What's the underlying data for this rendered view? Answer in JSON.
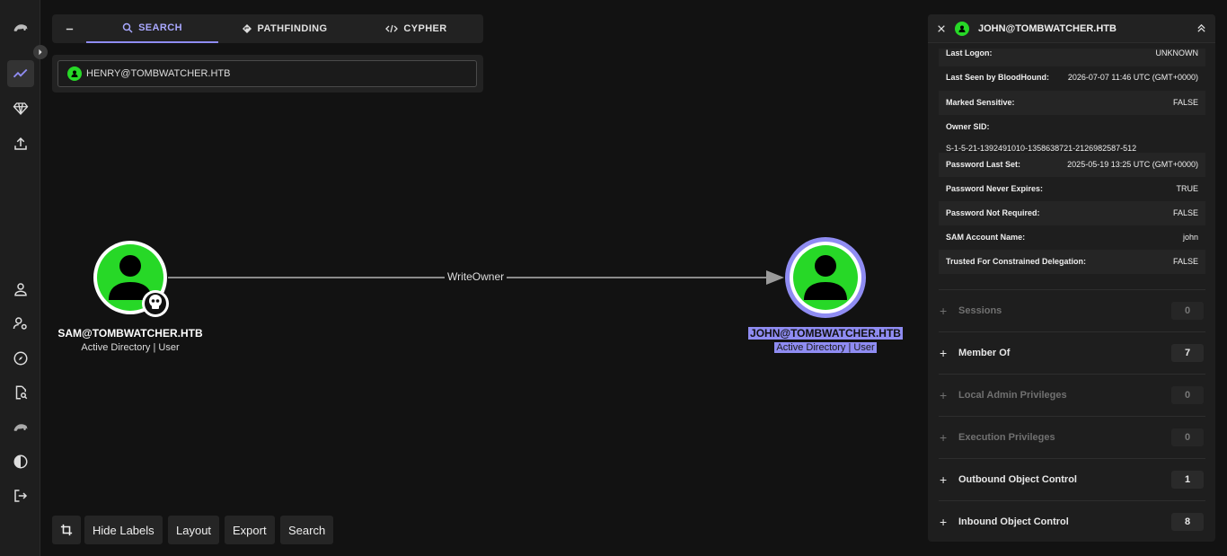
{
  "search": {
    "tabs": [
      {
        "label": "SEARCH",
        "icon": "search-icon"
      },
      {
        "label": "PATHFINDING",
        "icon": "diamond-icon"
      },
      {
        "label": "CYPHER",
        "icon": "code-icon"
      }
    ],
    "value": "HENRY@TOMBWATCHER.HTB"
  },
  "graph": {
    "source": {
      "name": "SAM@TOMBWATCHER.HTB",
      "sub": "Active Directory | User",
      "badge": "skull-icon"
    },
    "target": {
      "name": "JOHN@TOMBWATCHER.HTB",
      "sub": "Active Directory | User"
    },
    "edge": "WriteOwner",
    "colors": {
      "node": "#27d827",
      "selected": "#8f8cf2"
    }
  },
  "toolbar": {
    "hide_labels": "Hide Labels",
    "layout": "Layout",
    "export": "Export",
    "search": "Search"
  },
  "panel": {
    "title": "JOHN@TOMBWATCHER.HTB",
    "props": [
      {
        "k": "Last Logon:",
        "v": "UNKNOWN"
      },
      {
        "k": "Last Seen by BloodHound:",
        "v": "2026-07-07 11:46 UTC (GMT+0000)"
      },
      {
        "k": "Marked Sensitive:",
        "v": "FALSE"
      },
      {
        "k": "Owner SID:",
        "v": "S-1-5-21-1392491010-1358638721-2126982587-512"
      },
      {
        "k": "Password Last Set:",
        "v": "2025-05-19 13:25 UTC (GMT+0000)"
      },
      {
        "k": "Password Never Expires:",
        "v": "TRUE"
      },
      {
        "k": "Password Not Required:",
        "v": "FALSE"
      },
      {
        "k": "SAM Account Name:",
        "v": "john"
      },
      {
        "k": "Trusted For Constrained Delegation:",
        "v": "FALSE"
      }
    ],
    "sections": [
      {
        "name": "Sessions",
        "count": "0"
      },
      {
        "name": "Member Of",
        "count": "7"
      },
      {
        "name": "Local Admin Privileges",
        "count": "0"
      },
      {
        "name": "Execution Privileges",
        "count": "0"
      },
      {
        "name": "Outbound Object Control",
        "count": "1"
      },
      {
        "name": "Inbound Object Control",
        "count": "8"
      }
    ]
  }
}
